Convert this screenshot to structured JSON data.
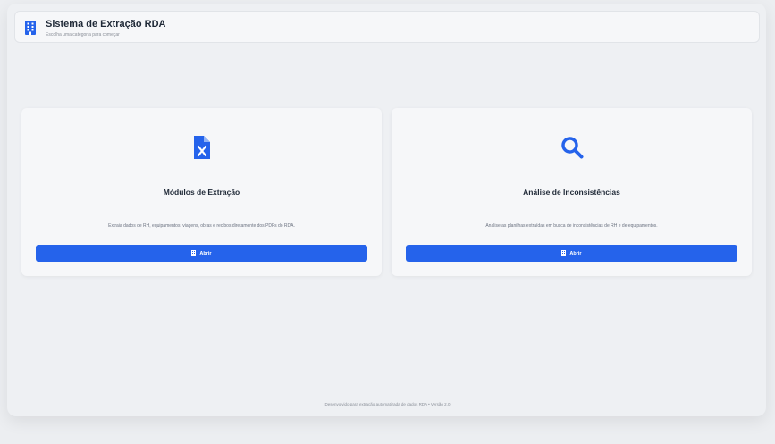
{
  "header": {
    "title": "Sistema de Extração RDA",
    "subtitle": "Escolha uma categoria para começar",
    "icon": "building-icon"
  },
  "cards": [
    {
      "icon": "excel-file-icon",
      "title": "Módulos de Extração",
      "description": "Extraia dados de RH, equipamentos, viagens, obras e recibos diretamente dos PDFs do RDA.",
      "button_label": "Abrir"
    },
    {
      "icon": "search-icon",
      "title": "Análise de Inconsistências",
      "description": "Analise as planilhas extraídas em busca de inconsistências de RH e de equipamentos.",
      "button_label": "Abrir"
    }
  ],
  "footer": {
    "text": "Desenvolvido para extração automatizada de dados RDA • Versão 2.0"
  },
  "colors": {
    "accent": "#2563eb",
    "background": "#eceef1",
    "card": "#f6f7f9"
  }
}
